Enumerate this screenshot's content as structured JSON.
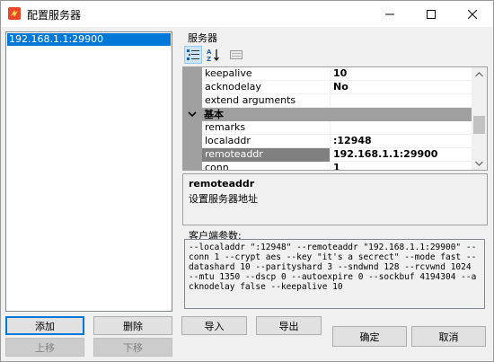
{
  "window": {
    "title": "配置服务器",
    "accent": "#0078d7"
  },
  "server_list": {
    "items": [
      "192.168.1.1:29900"
    ]
  },
  "property_panel": {
    "group_label": "服务器",
    "toolbar": [
      "categorized-icon",
      "sort-az-icon",
      "property-pages-icon"
    ],
    "rows_before_category": [
      {
        "name": "keepalive",
        "value": "10"
      },
      {
        "name": "acknodelay",
        "value": "No"
      },
      {
        "name": "extend arguments",
        "value": ""
      }
    ],
    "category": "基本",
    "rows_after_category": [
      {
        "name": "remarks",
        "value": ""
      },
      {
        "name": "localaddr",
        "value": ":12948"
      },
      {
        "name": "remoteaddr",
        "value": "192.168.1.1:29900",
        "selected": true
      },
      {
        "name": "conn",
        "value": "1"
      }
    ],
    "description": {
      "title": "remoteaddr",
      "text": "设置服务器地址"
    }
  },
  "client_params": {
    "label": "客户端参数:",
    "text": "--localaddr \":12948\" --remoteaddr \"192.168.1.1:29900\" --conn 1 --crypt aes --key \"it's a secrect\" --mode fast --datashard 10 --parityshard 3 --sndwnd 128 --rcvwnd 1024 --mtu 1350 --dscp 0 --autoexpire 0 --sockbuf 4194304 --acknodelay false --keepalive 10"
  },
  "buttons": {
    "add": "添加",
    "delete": "删除",
    "import": "导入",
    "export": "导出",
    "move_up": "上移",
    "move_down": "下移",
    "ok": "确定",
    "cancel": "取消"
  }
}
